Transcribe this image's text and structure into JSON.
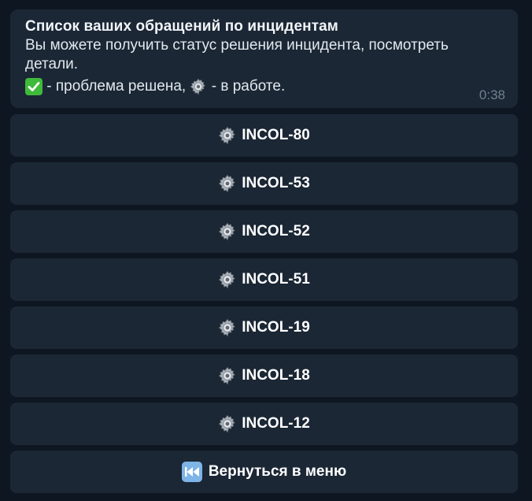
{
  "message": {
    "title": "Список ваших обращений по инцидентам",
    "text": "Вы можете получить статус решения инцидента, посмотреть детали.",
    "legend_solved": " - проблема решена, ",
    "legend_in_progress": " - в работе.",
    "time": "0:38"
  },
  "buttons": [
    {
      "label": "INCOL-80",
      "icon": "gear-icon"
    },
    {
      "label": "INCOL-53",
      "icon": "gear-icon"
    },
    {
      "label": "INCOL-52",
      "icon": "gear-icon"
    },
    {
      "label": "INCOL-51",
      "icon": "gear-icon"
    },
    {
      "label": "INCOL-19",
      "icon": "gear-icon"
    },
    {
      "label": "INCOL-18",
      "icon": "gear-icon"
    },
    {
      "label": "INCOL-12",
      "icon": "gear-icon"
    }
  ],
  "back_button": {
    "label": "Вернуться в меню",
    "icon": "rewind-icon"
  },
  "colors": {
    "background": "#0e1621",
    "bubble": "#1b2735",
    "button": "#1b2735",
    "time": "#6d7f8f",
    "check": "#3fba3a"
  }
}
